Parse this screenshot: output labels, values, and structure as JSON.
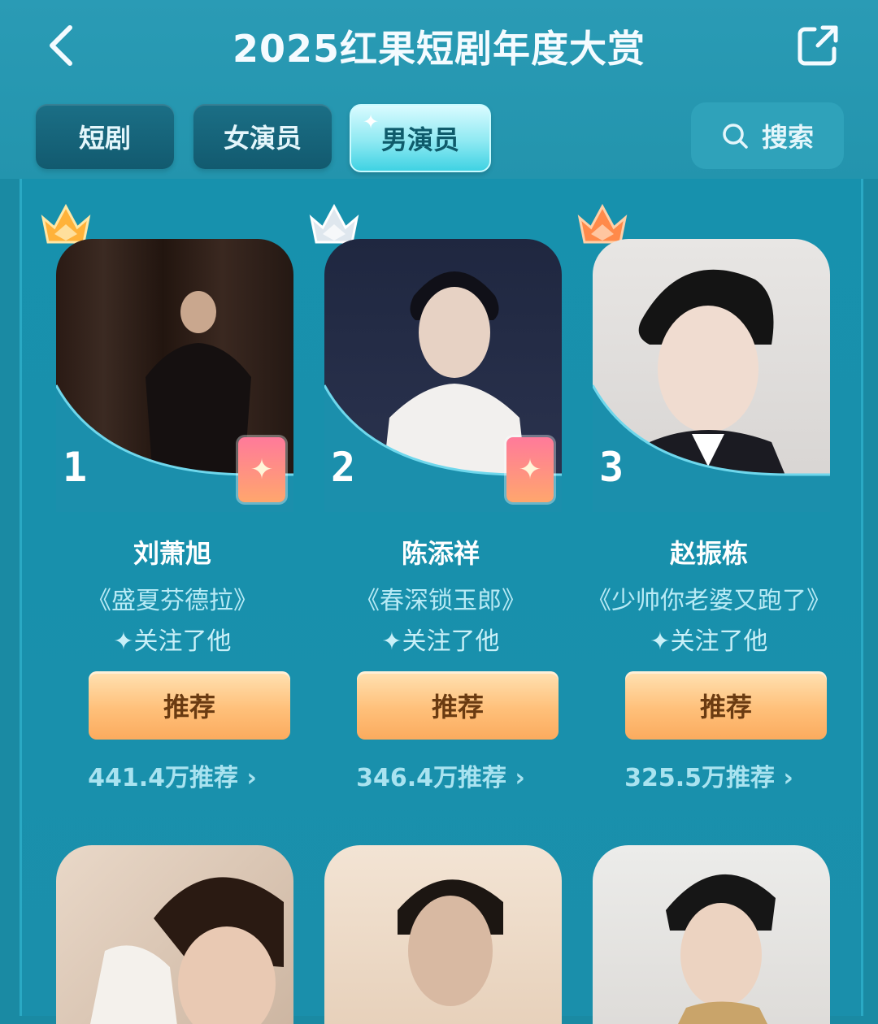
{
  "header": {
    "title": "2025红果短剧年度大赏",
    "back_icon": "chevron-left-icon",
    "share_icon": "share-external-icon"
  },
  "tabs": [
    {
      "label": "短剧",
      "active": false
    },
    {
      "label": "女演员",
      "active": false
    },
    {
      "label": "男演员",
      "active": true
    }
  ],
  "search": {
    "label": "搜索",
    "icon": "search-icon"
  },
  "actors": [
    {
      "rank": "1",
      "name": "刘萧旭",
      "drama": "《盛夏芬德拉》",
      "follow": "✦关注了他",
      "button": "推荐",
      "count": "441.4万推荐 ›",
      "crown_color": "#ffb23a"
    },
    {
      "rank": "2",
      "name": "陈添祥",
      "drama": "《春深锁玉郎》",
      "follow": "✦关注了他",
      "button": "推荐",
      "count": "346.4万推荐 ›",
      "crown_color": "#dfe7ee"
    },
    {
      "rank": "3",
      "name": "赵振栋",
      "drama": "《少帅你老婆又跑了》",
      "follow": "✦关注了他",
      "button": "推荐",
      "count": "325.5万推荐 ›",
      "crown_color": "#ff8a4a"
    }
  ],
  "colors": {
    "background": "#1a8aa3",
    "tab_active": "#8ee9f2",
    "button": "#ffc07a"
  }
}
